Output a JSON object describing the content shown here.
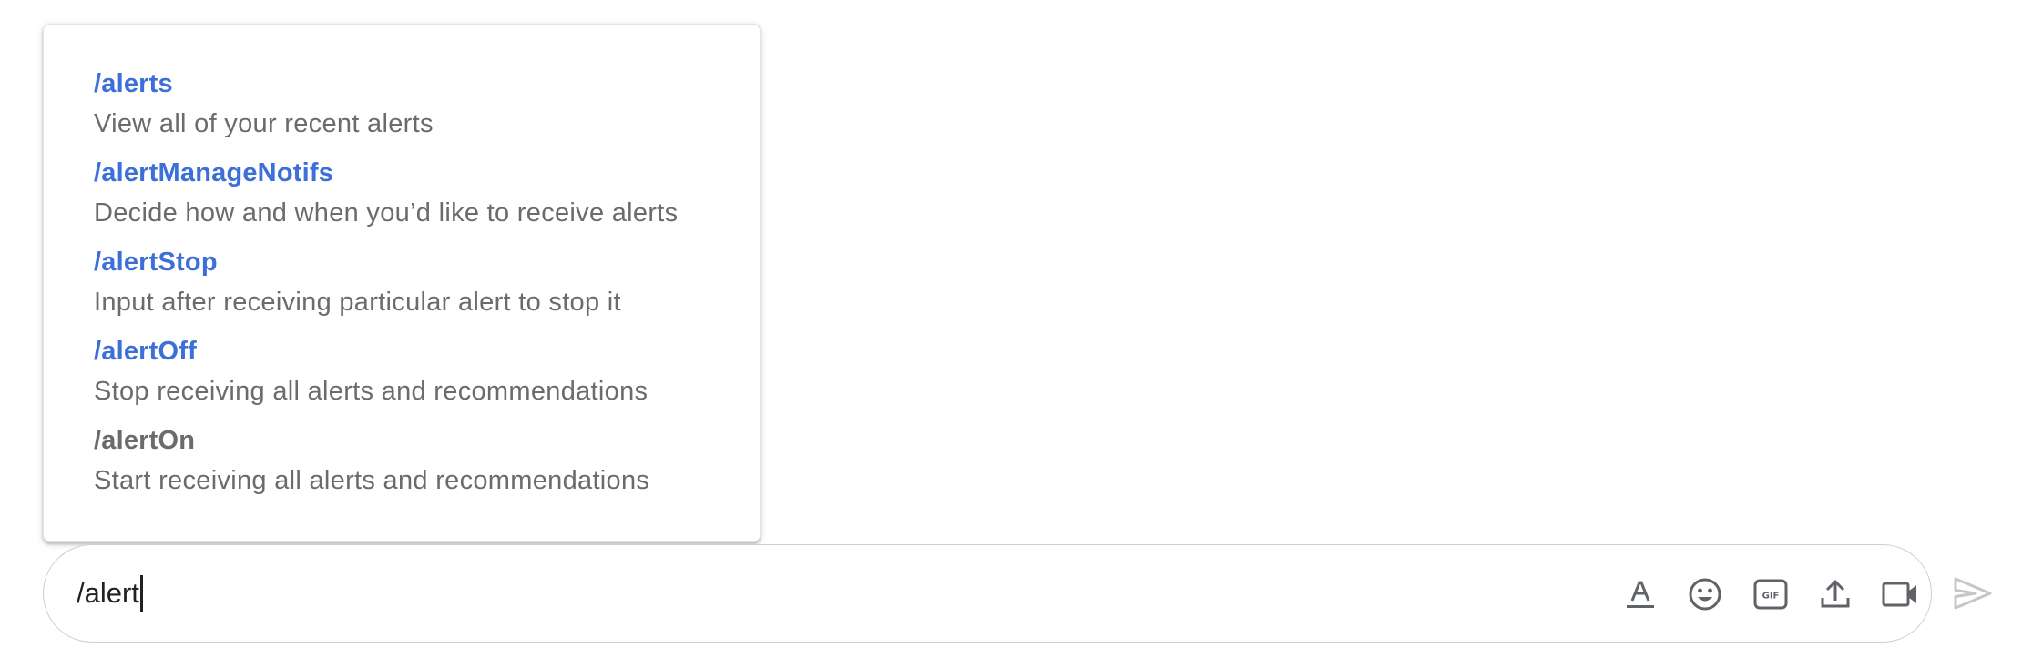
{
  "suggestions": [
    {
      "command": "/alerts",
      "description": "View all of your recent alerts"
    },
    {
      "command": "/alertManageNotifs",
      "description": "Decide how and when you’d like to receive alerts"
    },
    {
      "command": "/alertStop",
      "description": "Input after receiving particular alert to stop it"
    },
    {
      "command": "/alertOff",
      "description": "Stop receiving all alerts and recommendations"
    },
    {
      "command": "/alertOn",
      "description": "Start receiving all alerts and recommendations"
    }
  ],
  "composer": {
    "value": "/alert"
  },
  "toolbar": {
    "icons": [
      "format-text-icon",
      "emoji-icon",
      "gif-icon",
      "upload-icon",
      "video-meeting-icon"
    ],
    "gif_label": "GIF"
  },
  "send": {
    "icon": "send-icon"
  },
  "colors": {
    "command_link": "#3c6fd8",
    "command_muted": "#6b6b6b",
    "description": "#6b6b6b",
    "icon": "#5f6368",
    "send_disabled": "#c4c7c5"
  }
}
